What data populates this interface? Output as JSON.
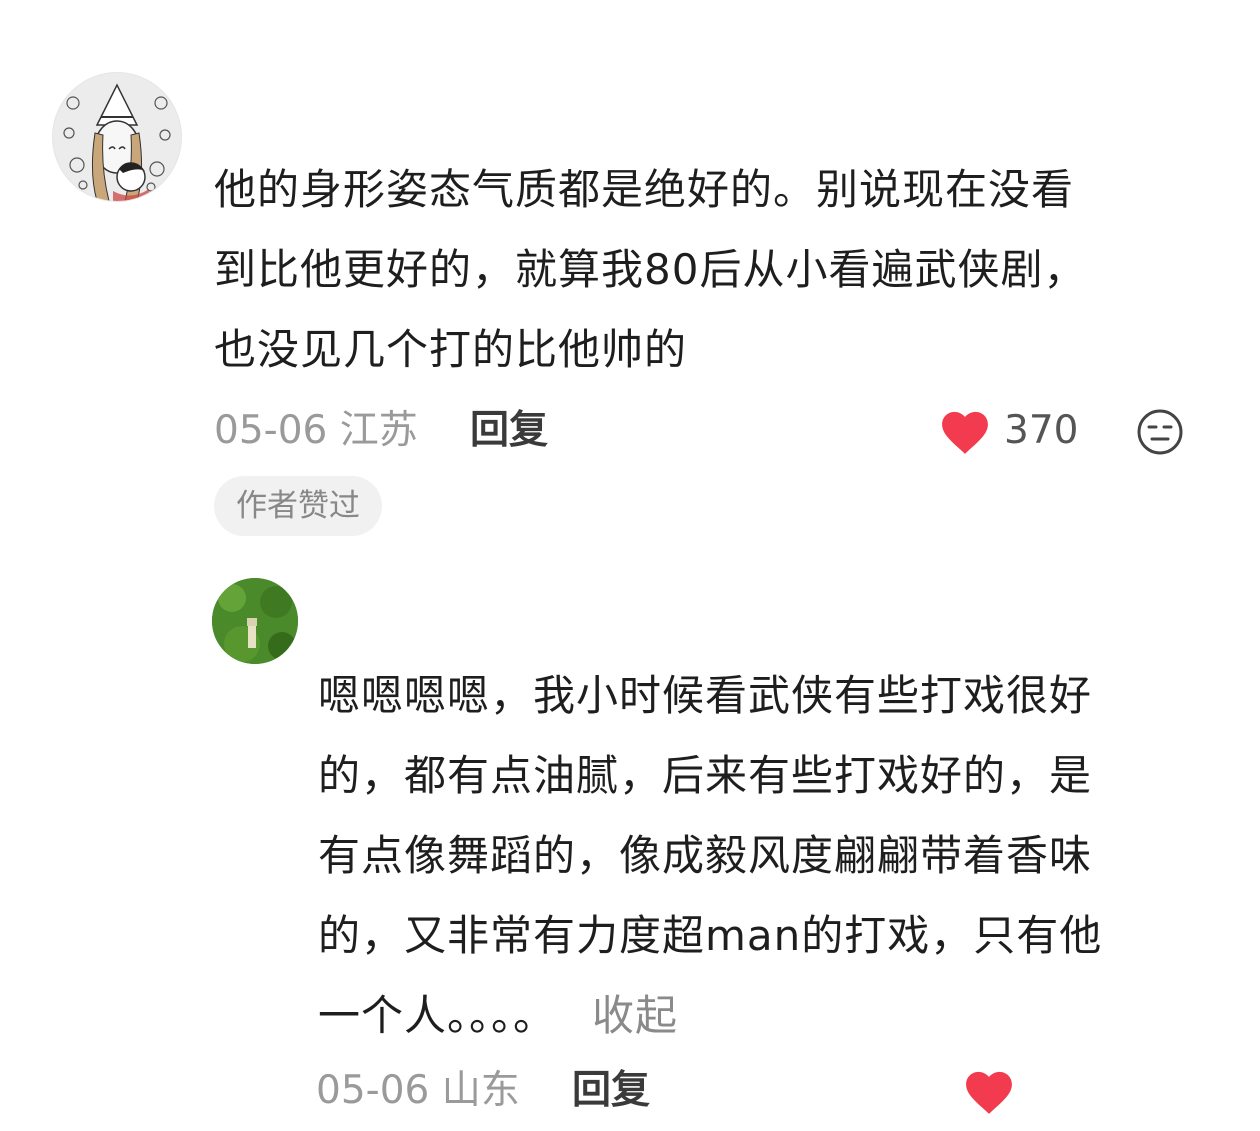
{
  "comments": [
    {
      "text_lines": [
        "他的身形姿态气质都是绝好的。别说现在没看",
        "到比他更好的，就算我80后从小看遍武侠剧，",
        "也没见几个打的比他帅的"
      ],
      "date": "05-06",
      "location": "江苏",
      "reply_label": "回复",
      "likes": "370",
      "badge": "作者赞过"
    },
    {
      "text_lines": [
        "嗯嗯嗯嗯，我小时候看武侠有些打戏很好",
        "的，都有点油腻，后来有些打戏好的，是",
        "有点像舞蹈的，像成毅风度翩翩带着香味",
        "的，又非常有力度超man的打戏，只有他",
        "一个人。。。。"
      ],
      "collapse_label": "收起",
      "date": "05-06",
      "location": "山东",
      "reply_label": "回复"
    }
  ],
  "colors": {
    "heart": "#f23b4f",
    "meta": "#9a9a9a",
    "badge_bg": "#f1f1f1"
  },
  "icons": {
    "like": "heart-icon",
    "dislike": "neutral-face-icon"
  }
}
